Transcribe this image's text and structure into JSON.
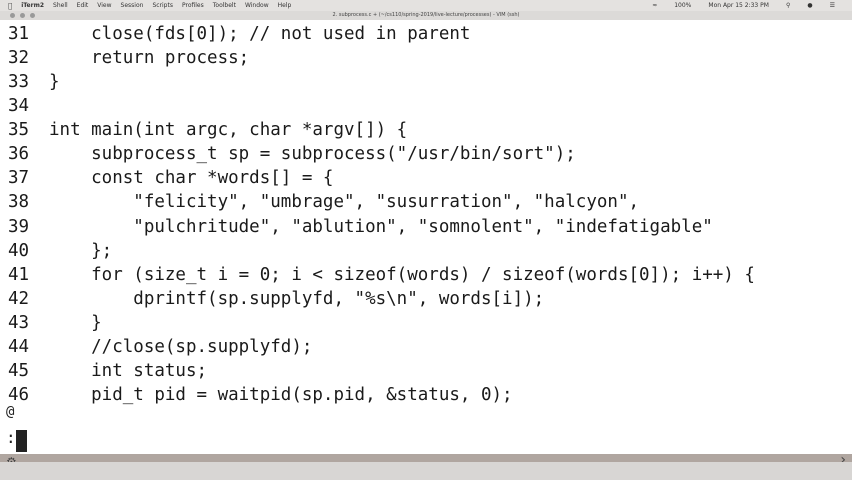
{
  "menubar": {
    "items": [
      "iTerm2",
      "Shell",
      "Edit",
      "View",
      "Session",
      "Scripts",
      "Profiles",
      "Toolbelt",
      "Window",
      "Help"
    ],
    "battery": "100%",
    "clock": "Mon Apr 15  2:33 PM"
  },
  "window": {
    "title": "2. subprocess.c + (~/cs110/spring-2019/live-lecture/processes) - VIM (ssh)"
  },
  "editor": {
    "lines": [
      {
        "n": "31",
        "code": "    close(fds[0]); // not used in parent"
      },
      {
        "n": "32",
        "code": "    return process;"
      },
      {
        "n": "33",
        "code": "}"
      },
      {
        "n": "34",
        "code": ""
      },
      {
        "n": "35",
        "code": "int main(int argc, char *argv[]) {"
      },
      {
        "n": "36",
        "code": "    subprocess_t sp = subprocess(\"/usr/bin/sort\");"
      },
      {
        "n": "37",
        "code": "    const char *words[] = {"
      },
      {
        "n": "38",
        "code": "        \"felicity\", \"umbrage\", \"susurration\", \"halcyon\","
      },
      {
        "n": "39",
        "code": "        \"pulchritude\", \"ablution\", \"somnolent\", \"indefatigable\""
      },
      {
        "n": "40",
        "code": "    };"
      },
      {
        "n": "41",
        "code": "    for (size_t i = 0; i < sizeof(words) / sizeof(words[0]); i++) {"
      },
      {
        "n": "42",
        "code": "        dprintf(sp.supplyfd, \"%s\\n\", words[i]);"
      },
      {
        "n": "43",
        "code": "    }"
      },
      {
        "n": "44",
        "code": "    //close(sp.supplyfd);"
      },
      {
        "n": "45",
        "code": "    int status;"
      },
      {
        "n": "46",
        "code": "    pid_t pid = waitpid(sp.pid, &status, 0);"
      }
    ],
    "continuation_marker": "@",
    "command_line": ":"
  }
}
